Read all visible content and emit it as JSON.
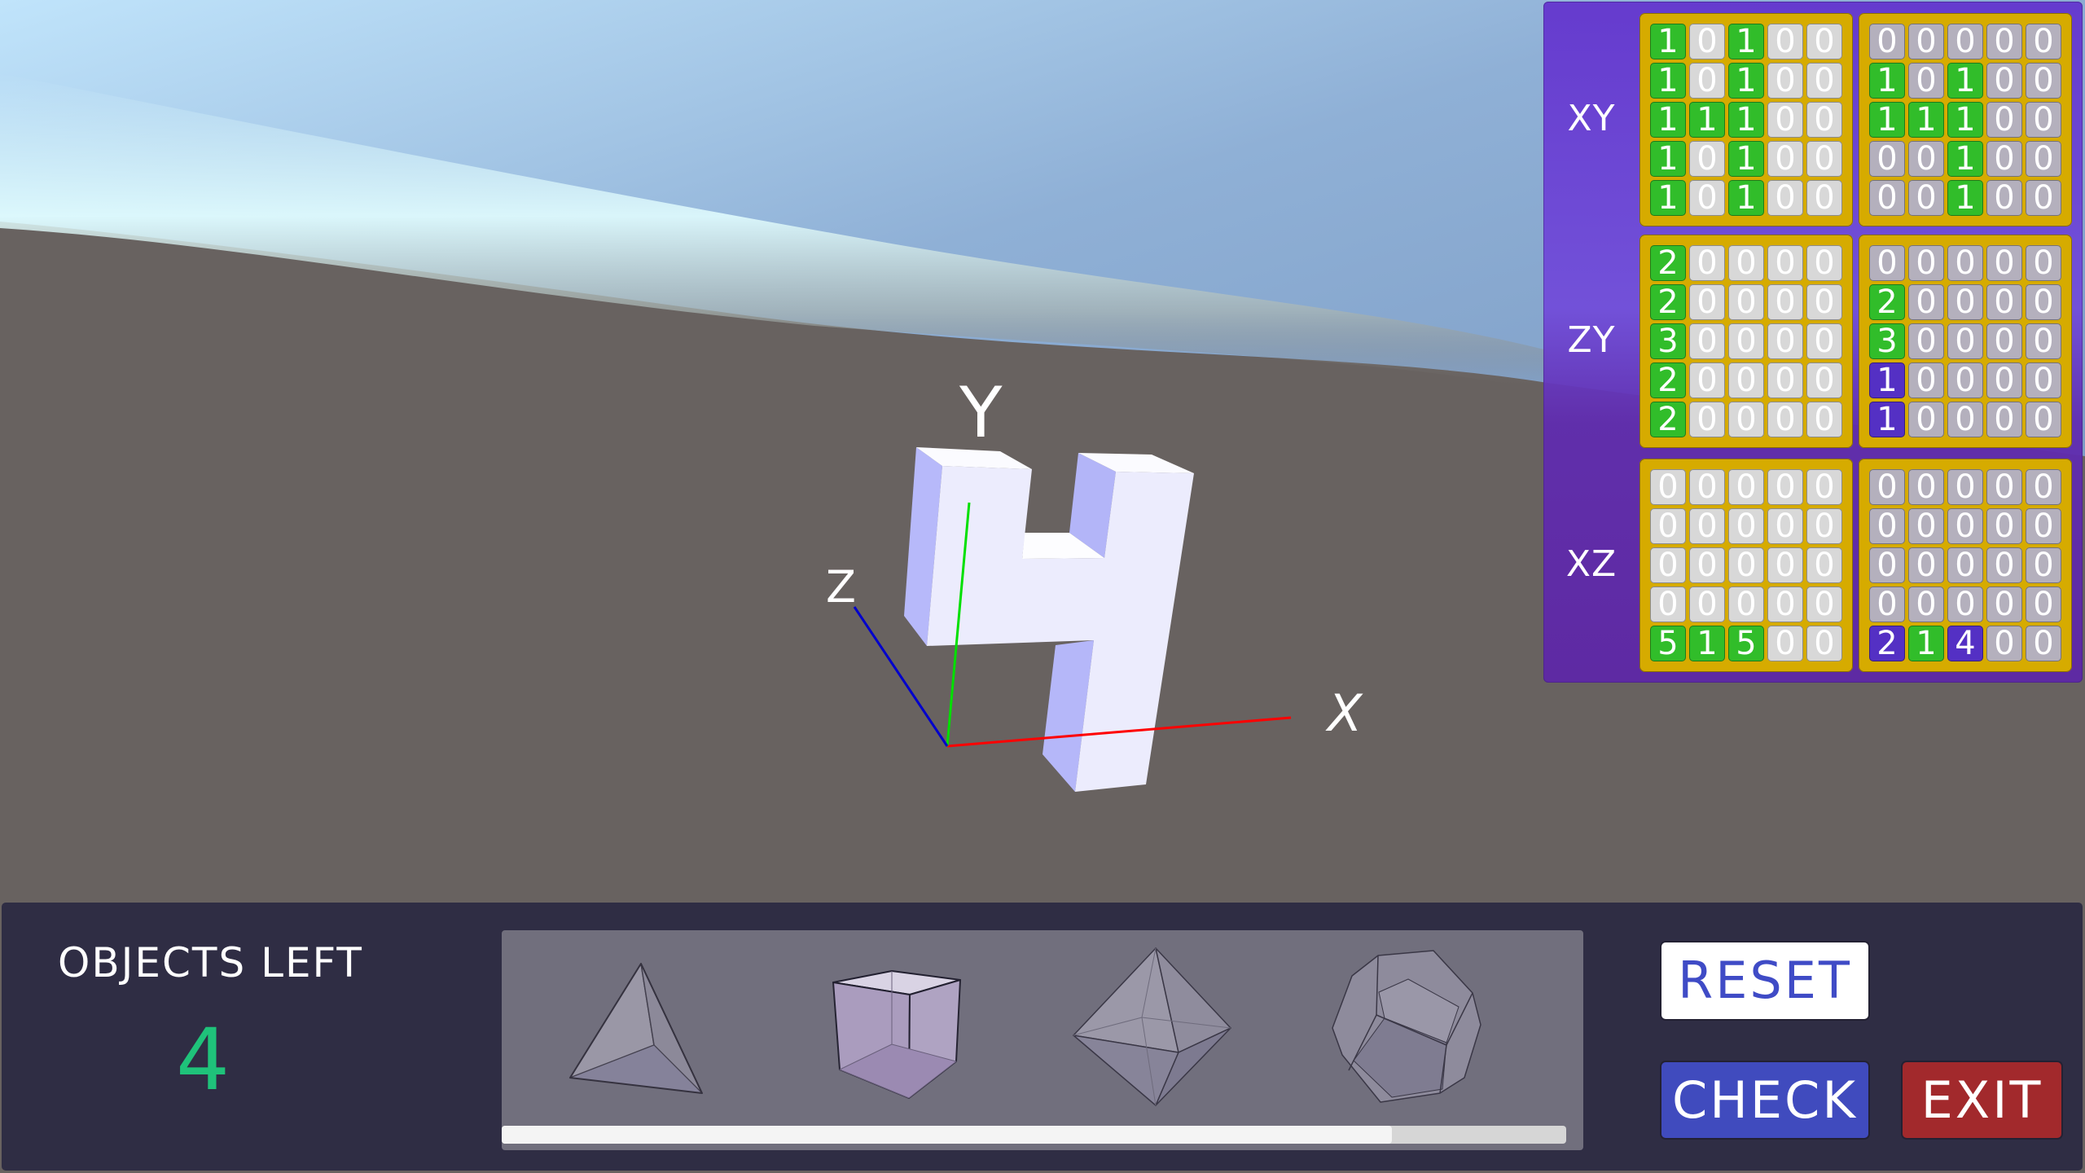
{
  "scene": {
    "axis_labels": {
      "x": "X",
      "y": "Y",
      "z": "Z"
    },
    "axis_colors": {
      "x": "#ff0000",
      "y": "#00e000",
      "z": "#0000cc"
    },
    "object_shape": "digit-4-extruded"
  },
  "projections": {
    "rows": [
      {
        "plane": "XY",
        "target": [
          [
            1,
            0,
            1,
            0,
            0
          ],
          [
            1,
            0,
            1,
            0,
            0
          ],
          [
            1,
            1,
            1,
            0,
            0
          ],
          [
            1,
            0,
            1,
            0,
            0
          ],
          [
            1,
            0,
            1,
            0,
            0
          ]
        ],
        "current": [
          [
            0,
            0,
            0,
            0,
            0
          ],
          [
            1,
            0,
            1,
            0,
            0
          ],
          [
            1,
            1,
            1,
            0,
            0
          ],
          [
            0,
            0,
            1,
            0,
            0
          ],
          [
            0,
            0,
            1,
            0,
            0
          ]
        ],
        "current_mismatch": [
          [
            0,
            0,
            0,
            0,
            0
          ],
          [
            0,
            0,
            0,
            0,
            0
          ],
          [
            0,
            0,
            0,
            0,
            0
          ],
          [
            0,
            0,
            0,
            0,
            0
          ],
          [
            0,
            0,
            0,
            0,
            0
          ]
        ]
      },
      {
        "plane": "ZY",
        "target": [
          [
            2,
            0,
            0,
            0,
            0
          ],
          [
            2,
            0,
            0,
            0,
            0
          ],
          [
            3,
            0,
            0,
            0,
            0
          ],
          [
            2,
            0,
            0,
            0,
            0
          ],
          [
            2,
            0,
            0,
            0,
            0
          ]
        ],
        "current": [
          [
            0,
            0,
            0,
            0,
            0
          ],
          [
            2,
            0,
            0,
            0,
            0
          ],
          [
            3,
            0,
            0,
            0,
            0
          ],
          [
            1,
            0,
            0,
            0,
            0
          ],
          [
            1,
            0,
            0,
            0,
            0
          ]
        ],
        "current_mismatch": [
          [
            0,
            0,
            0,
            0,
            0
          ],
          [
            0,
            0,
            0,
            0,
            0
          ],
          [
            0,
            0,
            0,
            0,
            0
          ],
          [
            1,
            0,
            0,
            0,
            0
          ],
          [
            1,
            0,
            0,
            0,
            0
          ]
        ]
      },
      {
        "plane": "XZ",
        "target": [
          [
            0,
            0,
            0,
            0,
            0
          ],
          [
            0,
            0,
            0,
            0,
            0
          ],
          [
            0,
            0,
            0,
            0,
            0
          ],
          [
            0,
            0,
            0,
            0,
            0
          ],
          [
            5,
            1,
            5,
            0,
            0
          ]
        ],
        "current": [
          [
            0,
            0,
            0,
            0,
            0
          ],
          [
            0,
            0,
            0,
            0,
            0
          ],
          [
            0,
            0,
            0,
            0,
            0
          ],
          [
            0,
            0,
            0,
            0,
            0
          ],
          [
            2,
            1,
            4,
            0,
            0
          ]
        ],
        "current_mismatch": [
          [
            0,
            0,
            0,
            0,
            0
          ],
          [
            0,
            0,
            0,
            0,
            0
          ],
          [
            0,
            0,
            0,
            0,
            0
          ],
          [
            0,
            0,
            0,
            0,
            0
          ],
          [
            1,
            0,
            1,
            0,
            0
          ]
        ]
      }
    ],
    "colors": {
      "filled": "#31bd2a",
      "mismatch": "#5430c4",
      "empty_target": "#d8d8d8",
      "empty_current": "#b4b0bd",
      "frame": "#d6ab00",
      "panel": "#6236cd"
    }
  },
  "bottom_bar": {
    "objects_left_label": "OBJECTS LEFT",
    "objects_left_count": "4",
    "shapes": [
      {
        "name": "tetrahedron"
      },
      {
        "name": "cube"
      },
      {
        "name": "octahedron"
      },
      {
        "name": "dodecahedron"
      }
    ],
    "scroll_position_fraction": 0.836,
    "buttons": {
      "reset": "RESET",
      "check": "CHECK",
      "exit": "EXIT"
    },
    "button_colors": {
      "reset_bg": "#ffffff",
      "reset_text": "#3f4bc6",
      "check_bg": "#404bbe",
      "exit_bg": "#a2292c"
    },
    "count_color": "#1fc27a"
  }
}
